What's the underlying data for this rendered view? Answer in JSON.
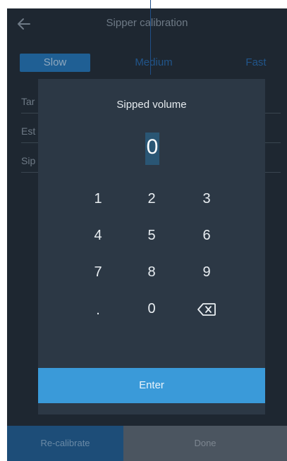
{
  "header": {
    "title": "Sipper calibration",
    "back_icon": "arrow-left-icon"
  },
  "speed_tabs": {
    "slow": "Slow",
    "medium": "Medium",
    "fast": "Fast",
    "selected": "Slow"
  },
  "rows": [
    {
      "label": "Tar"
    },
    {
      "label": "Est"
    },
    {
      "label": "Sip"
    }
  ],
  "footer": {
    "recalibrate_label": "Re-calibrate",
    "done_label": "Done"
  },
  "dialog": {
    "title": "Sipped volume",
    "value": "0",
    "enter_label": "Enter",
    "keys": {
      "k1": "1",
      "k2": "2",
      "k3": "3",
      "k4": "4",
      "k5": "5",
      "k6": "6",
      "k7": "7",
      "k8": "8",
      "k9": "9",
      "kdot": ".",
      "k0": "0",
      "backspace_icon": "backspace-icon"
    }
  },
  "colors": {
    "background": "#1e2731",
    "dialog": "#2c3845",
    "accent": "#3a9ad9",
    "selected_tab": "#1f5f94"
  }
}
